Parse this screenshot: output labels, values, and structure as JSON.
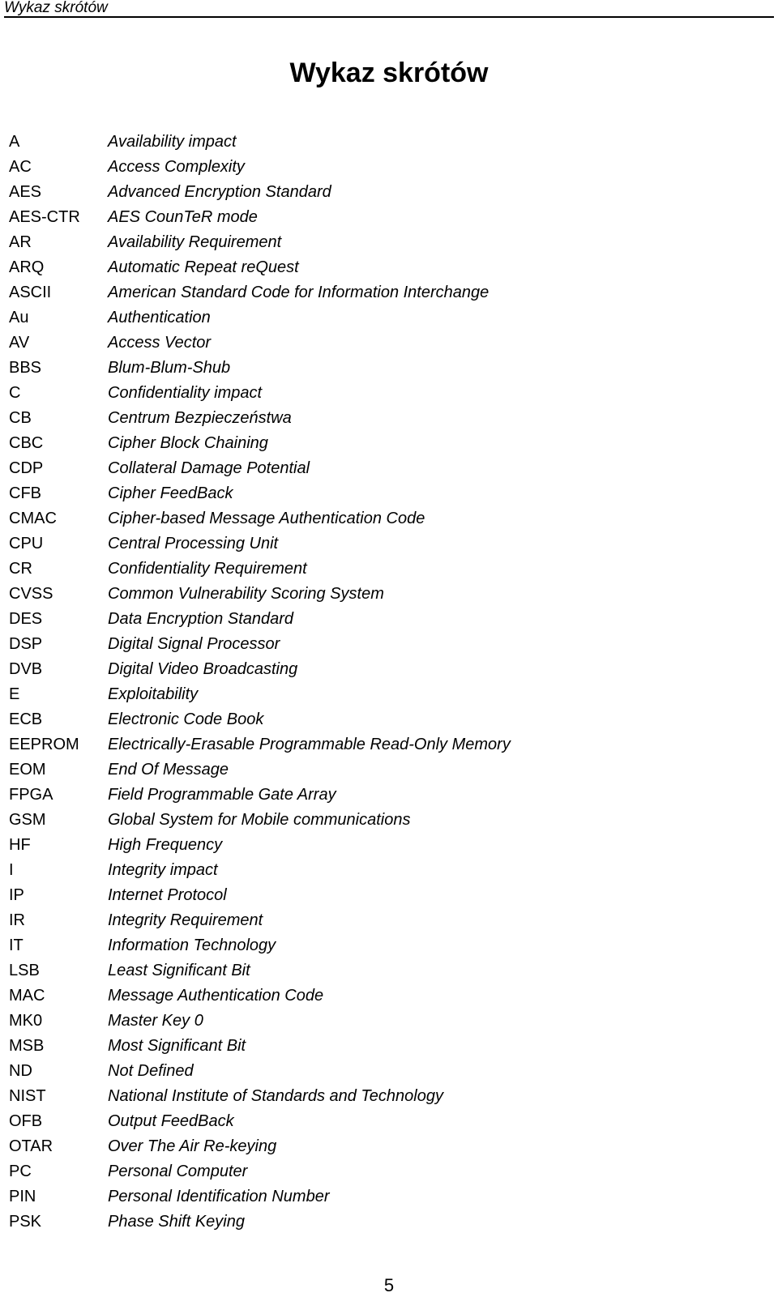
{
  "header": {
    "running_title": "Wykaz skrótów"
  },
  "title": "Wykaz skrótów",
  "entries": [
    {
      "abbr": "A",
      "def": "Availability impact"
    },
    {
      "abbr": "AC",
      "def": "Access Complexity"
    },
    {
      "abbr": "AES",
      "def": "Advanced Encryption Standard"
    },
    {
      "abbr": "AES-CTR",
      "def": "AES CounTeR mode"
    },
    {
      "abbr": "AR",
      "def": "Availability Requirement"
    },
    {
      "abbr": "ARQ",
      "def": "Automatic Repeat reQuest"
    },
    {
      "abbr": "ASCII",
      "def": "American Standard Code for Information Interchange"
    },
    {
      "abbr": "Au",
      "def": "Authentication"
    },
    {
      "abbr": "AV",
      "def": "Access Vector"
    },
    {
      "abbr": "BBS",
      "def": "Blum-Blum-Shub"
    },
    {
      "abbr": "C",
      "def": "Confidentiality impact"
    },
    {
      "abbr": "CB",
      "def": "Centrum Bezpieczeństwa"
    },
    {
      "abbr": "CBC",
      "def": "Cipher Block Chaining"
    },
    {
      "abbr": "CDP",
      "def": "Collateral Damage Potential"
    },
    {
      "abbr": "CFB",
      "def": "Cipher FeedBack"
    },
    {
      "abbr": "CMAC",
      "def": "Cipher-based Message Authentication Code"
    },
    {
      "abbr": "CPU",
      "def": "Central Processing Unit"
    },
    {
      "abbr": "CR",
      "def": "Confidentiality Requirement"
    },
    {
      "abbr": "CVSS",
      "def": "Common Vulnerability Scoring System"
    },
    {
      "abbr": "DES",
      "def": "Data Encryption Standard"
    },
    {
      "abbr": "DSP",
      "def": "Digital Signal Processor"
    },
    {
      "abbr": "DVB",
      "def": "Digital Video Broadcasting"
    },
    {
      "abbr": "E",
      "def": "Exploitability"
    },
    {
      "abbr": "ECB",
      "def": "Electronic Code Book"
    },
    {
      "abbr": "EEPROM",
      "def": "Electrically-Erasable Programmable Read-Only Memory"
    },
    {
      "abbr": "EOM",
      "def": "End Of Message"
    },
    {
      "abbr": "FPGA",
      "def": "Field Programmable Gate Array"
    },
    {
      "abbr": "GSM",
      "def": "Global System for Mobile communications"
    },
    {
      "abbr": "HF",
      "def": "High Frequency"
    },
    {
      "abbr": "I",
      "def": "Integrity impact"
    },
    {
      "abbr": "IP",
      "def": "Internet Protocol"
    },
    {
      "abbr": "IR",
      "def": "Integrity Requirement"
    },
    {
      "abbr": "IT",
      "def": "Information Technology"
    },
    {
      "abbr": "LSB",
      "def": "Least Significant Bit"
    },
    {
      "abbr": "MAC",
      "def": "Message Authentication Code"
    },
    {
      "abbr": "MK0",
      "def": "Master Key 0"
    },
    {
      "abbr": "MSB",
      "def": "Most Significant Bit"
    },
    {
      "abbr": "ND",
      "def": "Not Defined"
    },
    {
      "abbr": "NIST",
      "def": "National Institute of Standards and Technology"
    },
    {
      "abbr": "OFB",
      "def": "Output FeedBack"
    },
    {
      "abbr": "OTAR",
      "def": "Over The Air Re-keying"
    },
    {
      "abbr": "PC",
      "def": "Personal Computer"
    },
    {
      "abbr": "PIN",
      "def": "Personal Identification Number"
    },
    {
      "abbr": "PSK",
      "def": "Phase Shift Keying"
    }
  ],
  "footer": {
    "page_number": "5"
  }
}
